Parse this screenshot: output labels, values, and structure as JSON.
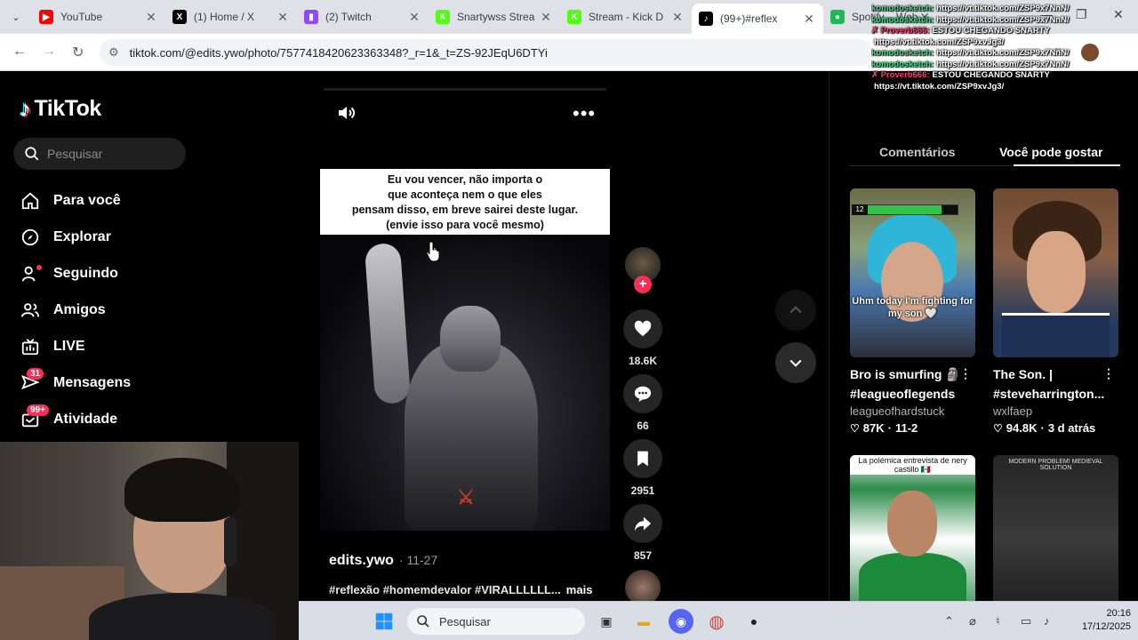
{
  "browser": {
    "tabs": [
      {
        "title": "YouTube",
        "fav_color": "#ff0000",
        "fav_glyph": "▶"
      },
      {
        "title": "(1) Home / X",
        "fav_color": "#000000",
        "fav_glyph": "X"
      },
      {
        "title": "(2) Twitch",
        "fav_color": "#9146ff",
        "fav_glyph": "▮"
      },
      {
        "title": "Snartywss Strea",
        "fav_color": "#53fc18",
        "fav_glyph": "K"
      },
      {
        "title": "Stream - Kick D",
        "fav_color": "#53fc18",
        "fav_glyph": "K"
      },
      {
        "title": "(99+)#reflex",
        "fav_color": "#000000",
        "fav_glyph": "♪"
      },
      {
        "title": "Spotify – Web p",
        "fav_color": "#1db954",
        "fav_glyph": "●"
      }
    ],
    "active_tab_index": 5,
    "url": "tiktok.com/@edits.ywo/photo/7577418420623363348?_r=1&_t=ZS-92JEqU6DTYi"
  },
  "sidebar": {
    "logo": "TikTok",
    "search_placeholder": "Pesquisar",
    "items": [
      {
        "label": "Para você",
        "icon": "home-icon"
      },
      {
        "label": "Explorar",
        "icon": "compass-icon"
      },
      {
        "label": "Seguindo",
        "icon": "following-icon"
      },
      {
        "label": "Amigos",
        "icon": "friends-icon"
      },
      {
        "label": "LIVE",
        "icon": "live-icon"
      },
      {
        "label": "Mensagens",
        "icon": "messages-icon",
        "badge": "31"
      },
      {
        "label": "Atividade",
        "icon": "activity-icon",
        "badge": "99+"
      }
    ]
  },
  "post": {
    "caption_lines": [
      "Eu vou vencer, não importa o",
      "que aconteça nem o que eles",
      "pensam disso, em breve sairei deste lugar.",
      "(envie isso para você mesmo)"
    ],
    "author": "edits.ywo",
    "date": "11-27",
    "hashtags": "#reflexão #homemdevalor #VIRALLLLLL...",
    "more_label": "mais",
    "likes": "18.6K",
    "comments": "66",
    "saves": "2951",
    "shares": "857"
  },
  "right_panel": {
    "tabs": [
      "Comentários",
      "Você pode gostar"
    ],
    "active_tab_index": 1,
    "cards": [
      {
        "title1": "Bro is smurfing 🗿",
        "title2": "#leagueoflegends",
        "author": "leagueofhardstuck",
        "likes": "87K",
        "date": "11-2",
        "thumb_text": "Uhm today I'm fighting for my son 🤍",
        "level": "12"
      },
      {
        "title1": "The Son. |",
        "title2": "#steveharrington...",
        "author": "wxlfaep",
        "likes": "94.8K",
        "date": "3 d atrás"
      },
      {
        "thumb_text": "La polémica entrevista de nery castillo 🇲🇽"
      },
      {
        "thumb_text": "MODERN PROBLEM! MEDIEVAL SOLUTION"
      }
    ]
  },
  "chat": [
    {
      "user": "komodosketch:",
      "msg": "https://vt.tiktok.com/ZSP9x7NnN/",
      "cls": "u1"
    },
    {
      "user": "komodosketch:",
      "msg": "https://vt.tiktok.com/ZSP9x7NnN/",
      "cls": "u1"
    },
    {
      "user": "✗ Proverb666:",
      "msg": "ESTOU CHEGANDO SNARTY",
      "cls": "u2"
    },
    {
      "user": "",
      "msg": "https://vt.tiktok.com/ZSP9xvJg3/",
      "cls": "u2"
    },
    {
      "user": "komodosketch:",
      "msg": "https://vt.tiktok.com/ZSP9x7NnN/",
      "cls": "u1"
    },
    {
      "user": "komodosketch:",
      "msg": "https://vt.tiktok.com/ZSP9x7NnN/",
      "cls": "u1"
    },
    {
      "user": "✗ Proverb666:",
      "msg": "ESTOU CHEGANDO SNARTY",
      "cls": "u2"
    },
    {
      "user": "",
      "msg": "https://vt.tiktok.com/ZSP9xvJg3/",
      "cls": "u2"
    }
  ],
  "taskbar": {
    "search_placeholder": "Pesquisar",
    "time": "20:16",
    "date": "17/12/2025"
  },
  "colors": {
    "accent": "#fe2c55",
    "bg": "#000000"
  }
}
